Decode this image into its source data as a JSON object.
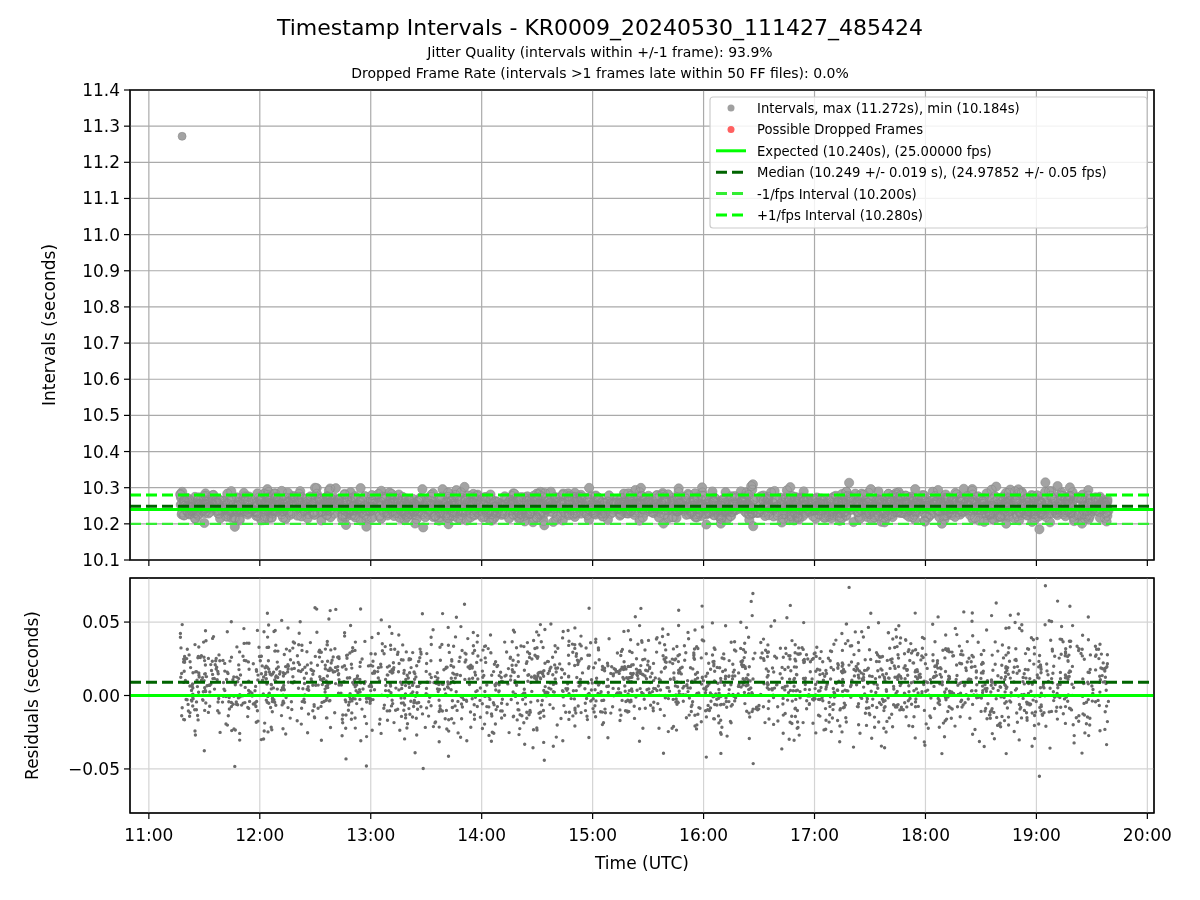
{
  "figure": {
    "title": "Timestamp Intervals - KR0009_20240530_111427_485424",
    "subtitles": [
      "Jitter Quality (intervals within +/-1 frame): 93.9%",
      "Dropped Frame Rate (intervals >1 frames late within 50 FF files): 0.0%"
    ]
  },
  "intervals_plot": {
    "legend_markers": [
      {
        "label": "Intervals, max (11.272s), min (10.184s)",
        "color": "#a0a0a0"
      },
      {
        "label": "Possible Dropped Frames",
        "color": "#ff6060"
      }
    ],
    "chart_data": {
      "type": "line",
      "ylabel": "Intervals (seconds)",
      "x": [
        10.83,
        20.06
      ],
      "series": [
        {
          "name": "Expected (10.240s), (25.00000 fps)",
          "color": "#00ff00",
          "line_style": "solid",
          "values": [
            10.24,
            10.24
          ]
        },
        {
          "name": "Median (10.249 +/- 0.019 s), (24.97852 +/- 0.05 fps)",
          "color": "#006400",
          "line_style": "dashed",
          "values": [
            10.249,
            10.249
          ]
        },
        {
          "name": "-1/fps Interval (10.200s)",
          "color": "#33ee33",
          "line_style": "dashed",
          "values": [
            10.2,
            10.2
          ]
        },
        {
          "name": "+1/fps Interval (10.280s)",
          "color": "#00ff00",
          "line_style": "dashed",
          "values": [
            10.28,
            10.28
          ]
        }
      ],
      "xlim": [
        10.83,
        20.06
      ],
      "ylim": [
        10.1,
        11.4
      ],
      "grid": true,
      "legend": true,
      "yticks": [
        {
          "value": 10.1,
          "label": "10.1"
        },
        {
          "value": 10.2,
          "label": "10.2"
        },
        {
          "value": 10.3,
          "label": "10.3"
        },
        {
          "value": 10.4,
          "label": "10.4"
        },
        {
          "value": 10.5,
          "label": "10.5"
        },
        {
          "value": 10.6,
          "label": "10.6"
        },
        {
          "value": 10.7,
          "label": "10.7"
        },
        {
          "value": 10.8,
          "label": "10.8"
        },
        {
          "value": 10.9,
          "label": "10.9"
        },
        {
          "value": 11.0,
          "label": "11.0"
        },
        {
          "value": 11.1,
          "label": "11.1"
        },
        {
          "value": 11.2,
          "label": "11.2"
        },
        {
          "value": 11.3,
          "label": "11.3"
        },
        {
          "value": 11.4,
          "label": "11.4"
        }
      ]
    }
  },
  "residuals_plot": {
    "chart_data": {
      "type": "line",
      "xlabel": "Time (UTC)",
      "ylabel": "Residuals (seconds)",
      "x": [
        10.83,
        20.06
      ],
      "series": [
        {
          "color": "#006400",
          "line_style": "dashed",
          "values": [
            0.009,
            0.009
          ]
        },
        {
          "color": "#00ff00",
          "line_style": "solid",
          "values": [
            0,
            0
          ]
        }
      ],
      "xlim": [
        10.83,
        20.06
      ],
      "ylim": [
        -0.08,
        0.08
      ],
      "grid": true,
      "xticks": [
        {
          "value": 11,
          "label": "11:00"
        },
        {
          "value": 12,
          "label": "12:00"
        },
        {
          "value": 13,
          "label": "13:00"
        },
        {
          "value": 14,
          "label": "14:00"
        },
        {
          "value": 15,
          "label": "15:00"
        },
        {
          "value": 16,
          "label": "16:00"
        },
        {
          "value": 17,
          "label": "17:00"
        },
        {
          "value": 18,
          "label": "18:00"
        },
        {
          "value": 19,
          "label": "19:00"
        },
        {
          "value": 20,
          "label": "20:00"
        }
      ],
      "yticks": [
        {
          "value": 0.05,
          "label": "0.05"
        },
        {
          "value": 0,
          "label": "0.00"
        },
        {
          "value": -0.05,
          "label": "−0.05"
        }
      ]
    }
  }
}
